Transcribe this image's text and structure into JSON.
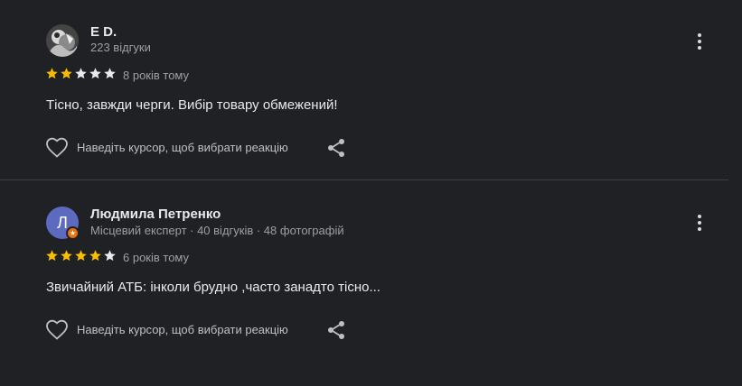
{
  "reviews": [
    {
      "author": "E D.",
      "meta": "223 відгуки",
      "rating": 2,
      "date": "8 років тому",
      "text": "Тісно, завжди черги. Вибір товару обмежений!",
      "avatar_letter": "",
      "react_label": "Наведіть курсор, щоб вибрати реакцію"
    },
    {
      "author": "Людмила Петренко",
      "meta": "Місцевий експерт · 40 відгуків · 48 фотографій",
      "rating": 4,
      "date": "6 років тому",
      "text": "Звичайний АТБ: інколи брудно ,часто занадто тісно...",
      "avatar_letter": "Л",
      "react_label": "Наведіть курсор, щоб вибрати реакцію"
    }
  ],
  "icons": {
    "more": "more-vert-icon",
    "heart": "heart-outline-icon",
    "share": "share-icon",
    "star_filled": "star-icon",
    "guide_badge": "local-guide-star-icon"
  },
  "colors": {
    "background": "#202124",
    "star_filled": "#fbbc04",
    "star_empty": "#e8eaed",
    "avatar_2": "#5c6bc0",
    "guide_badge": "#e8710a"
  }
}
